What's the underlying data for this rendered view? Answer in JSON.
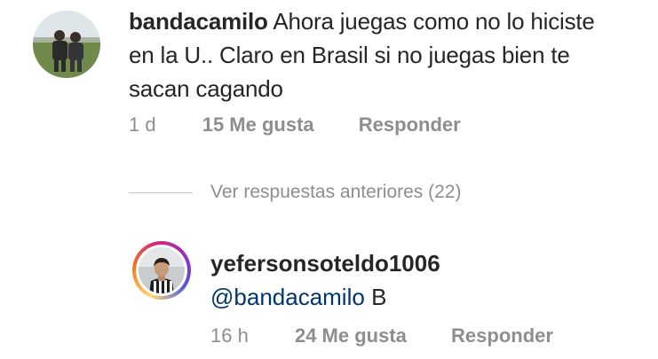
{
  "comments": [
    {
      "username": "bandacamilo",
      "text": "Ahora juegas como no lo hiciste en la U.. Claro en Brasil si no juegas bien te sacan cagando",
      "time": "1 d",
      "likes": "15 Me gusta",
      "reply_label": "Responder"
    }
  ],
  "replies_toggle": {
    "label": "Ver respuestas anteriores (22)"
  },
  "reply": {
    "username": "yefersonsoteldo1006",
    "mention": "@bandacamilo",
    "text": "B",
    "time": "16 h",
    "likes": "24 Me gusta",
    "reply_label": "Responder"
  },
  "colors": {
    "text": "#262626",
    "secondary": "#8e8e8e",
    "mention": "#00376b",
    "divider": "#c7c7c7"
  }
}
